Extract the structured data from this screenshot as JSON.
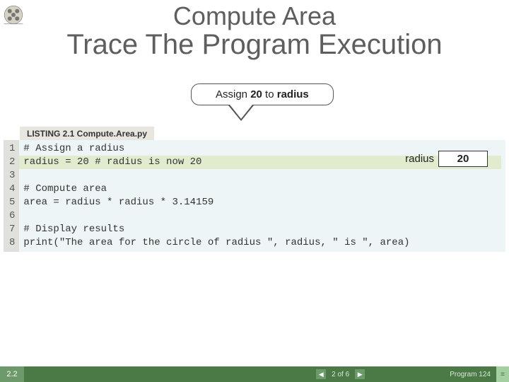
{
  "title": {
    "line1": "Compute Area",
    "line2": "Trace The Program Execution"
  },
  "callout": {
    "prefix": "Assign ",
    "value": "20",
    "mid": " to ",
    "target": "radius"
  },
  "listing_label": "LISTING 2.1 Compute.Area.py",
  "code": {
    "line_numbers": [
      "1",
      "2",
      "3",
      "4",
      "5",
      "6",
      "7",
      "8"
    ],
    "l1": "# Assign a radius",
    "l2": "radius = 20 # radius is now 20",
    "l3": "",
    "l4": "# Compute area",
    "l5": "area = radius * radius * 3.14159",
    "l6": "",
    "l7": "# Display results",
    "l8": "print(\"The area for the circle of radius \", radius, \" is \", area)"
  },
  "var": {
    "name": "radius",
    "value": "20"
  },
  "footer": {
    "section": "2.2",
    "step": "2 of 6",
    "program": "Program 1",
    "page": "24"
  },
  "icons": {
    "prev": "◀",
    "next": "▶",
    "end": "≡"
  }
}
